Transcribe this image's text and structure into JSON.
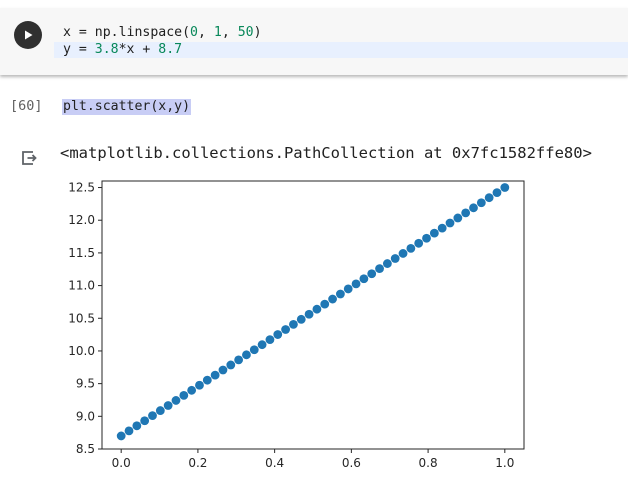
{
  "code_cell": {
    "line1": {
      "prefix": "x = np.linspace(",
      "arg1": "0",
      "sep1": ", ",
      "arg2": "1",
      "sep2": ", ",
      "arg3": "50",
      "suffix": ")"
    },
    "line2": {
      "prefix": "y = ",
      "coef": "3.8",
      "mid": "*x + ",
      "intercept": "8.7"
    }
  },
  "executed_cell": {
    "count": "[60]",
    "code": "plt.scatter(x,y)"
  },
  "output": {
    "text": "<matplotlib.collections.PathCollection at 0x7fc1582ffe80>"
  },
  "colors": {
    "marker": "#1f77b4",
    "number": "#09885a"
  },
  "chart_data": {
    "type": "scatter",
    "n_points": 50,
    "x_range": [
      0,
      1
    ],
    "slope": 3.8,
    "intercept": 8.7,
    "xlim": [
      -0.05,
      1.05
    ],
    "ylim": [
      8.5,
      12.6
    ],
    "xticks": [
      "0.0",
      "0.2",
      "0.4",
      "0.6",
      "0.8",
      "1.0"
    ],
    "yticks": [
      "8.5",
      "9.0",
      "9.5",
      "10.0",
      "10.5",
      "11.0",
      "11.5",
      "12.0",
      "12.5"
    ],
    "title": "",
    "xlabel": "",
    "ylabel": "",
    "grid": false
  }
}
